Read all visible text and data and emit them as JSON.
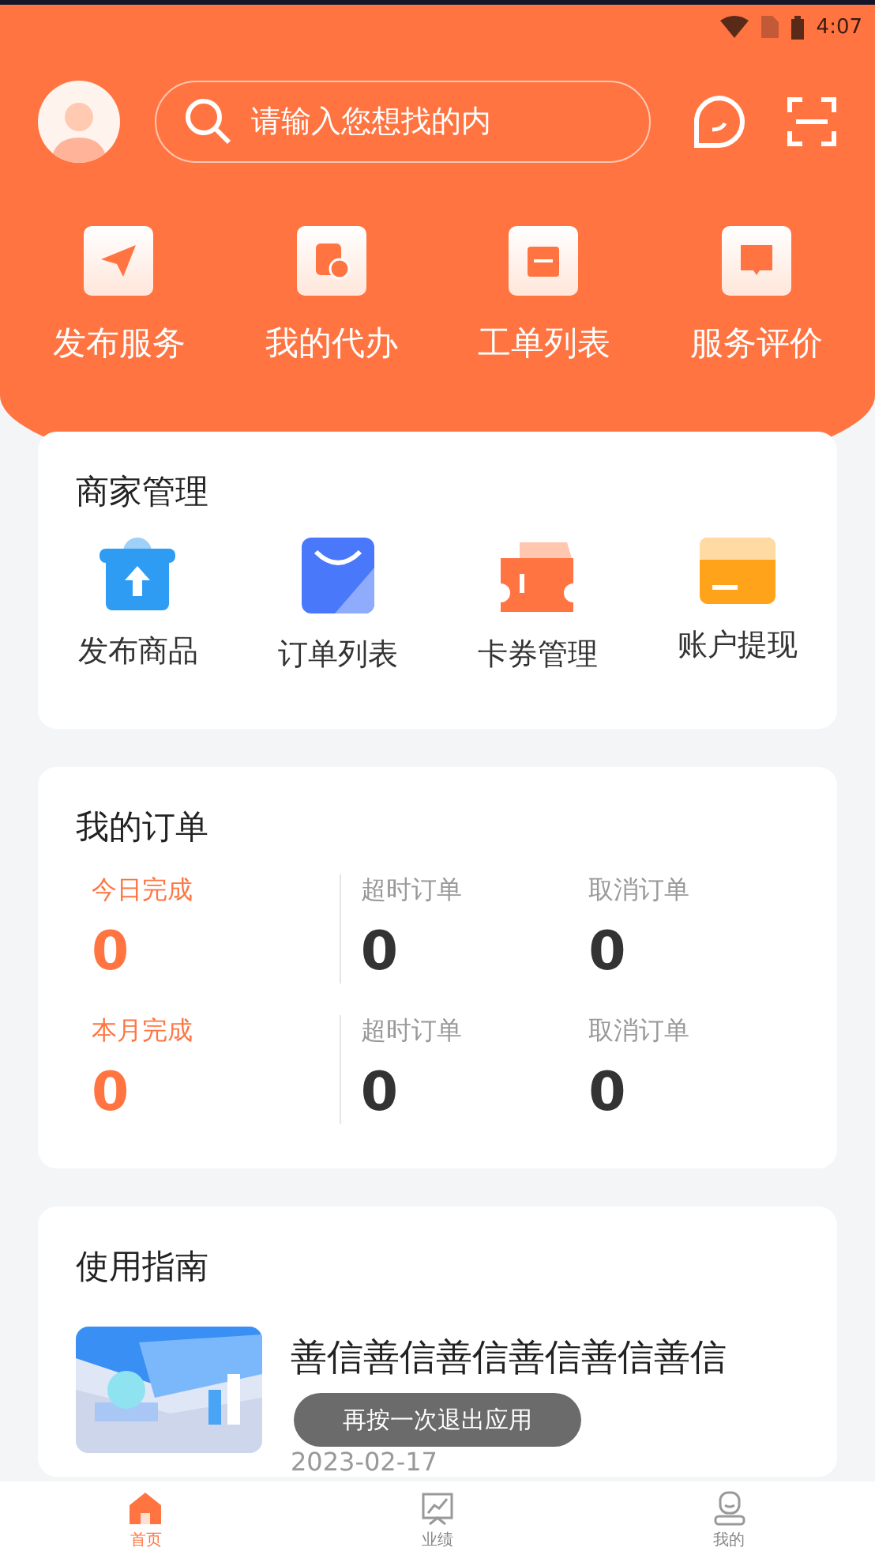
{
  "status_bar": {
    "time": "4:07"
  },
  "search": {
    "placeholder": "请输入您想找的内"
  },
  "quick_actions": [
    {
      "label": "发布服务",
      "kind": "plane"
    },
    {
      "label": "我的代办",
      "kind": "clock"
    },
    {
      "label": "工单列表",
      "kind": "calendar"
    },
    {
      "label": "服务评价",
      "kind": "comment"
    }
  ],
  "merchant": {
    "title": "商家管理",
    "items": [
      {
        "label": "发布商品",
        "kind": "upload"
      },
      {
        "label": "订单列表",
        "kind": "bag"
      },
      {
        "label": "卡券管理",
        "kind": "ticket"
      },
      {
        "label": "账户提现",
        "kind": "card"
      }
    ]
  },
  "orders": {
    "title": "我的订单",
    "rows": [
      [
        {
          "label": "今日完成",
          "value": "0",
          "highlight": true
        },
        {
          "label": "超时订单",
          "value": "0",
          "highlight": false
        },
        {
          "label": "取消订单",
          "value": "0",
          "highlight": false
        }
      ],
      [
        {
          "label": "本月完成",
          "value": "0",
          "highlight": true
        },
        {
          "label": "超时订单",
          "value": "0",
          "highlight": false
        },
        {
          "label": "取消订单",
          "value": "0",
          "highlight": false
        }
      ]
    ]
  },
  "guide": {
    "title": "使用指南",
    "articles": [
      {
        "title": "善信善信善信善信善信善信",
        "date": "2023-02-17"
      }
    ]
  },
  "toast": "再按一次退出应用",
  "tabs": [
    {
      "label": "首页",
      "kind": "home",
      "selected": true
    },
    {
      "label": "业绩",
      "kind": "chart",
      "selected": false
    },
    {
      "label": "我的",
      "kind": "user",
      "selected": false
    }
  ]
}
